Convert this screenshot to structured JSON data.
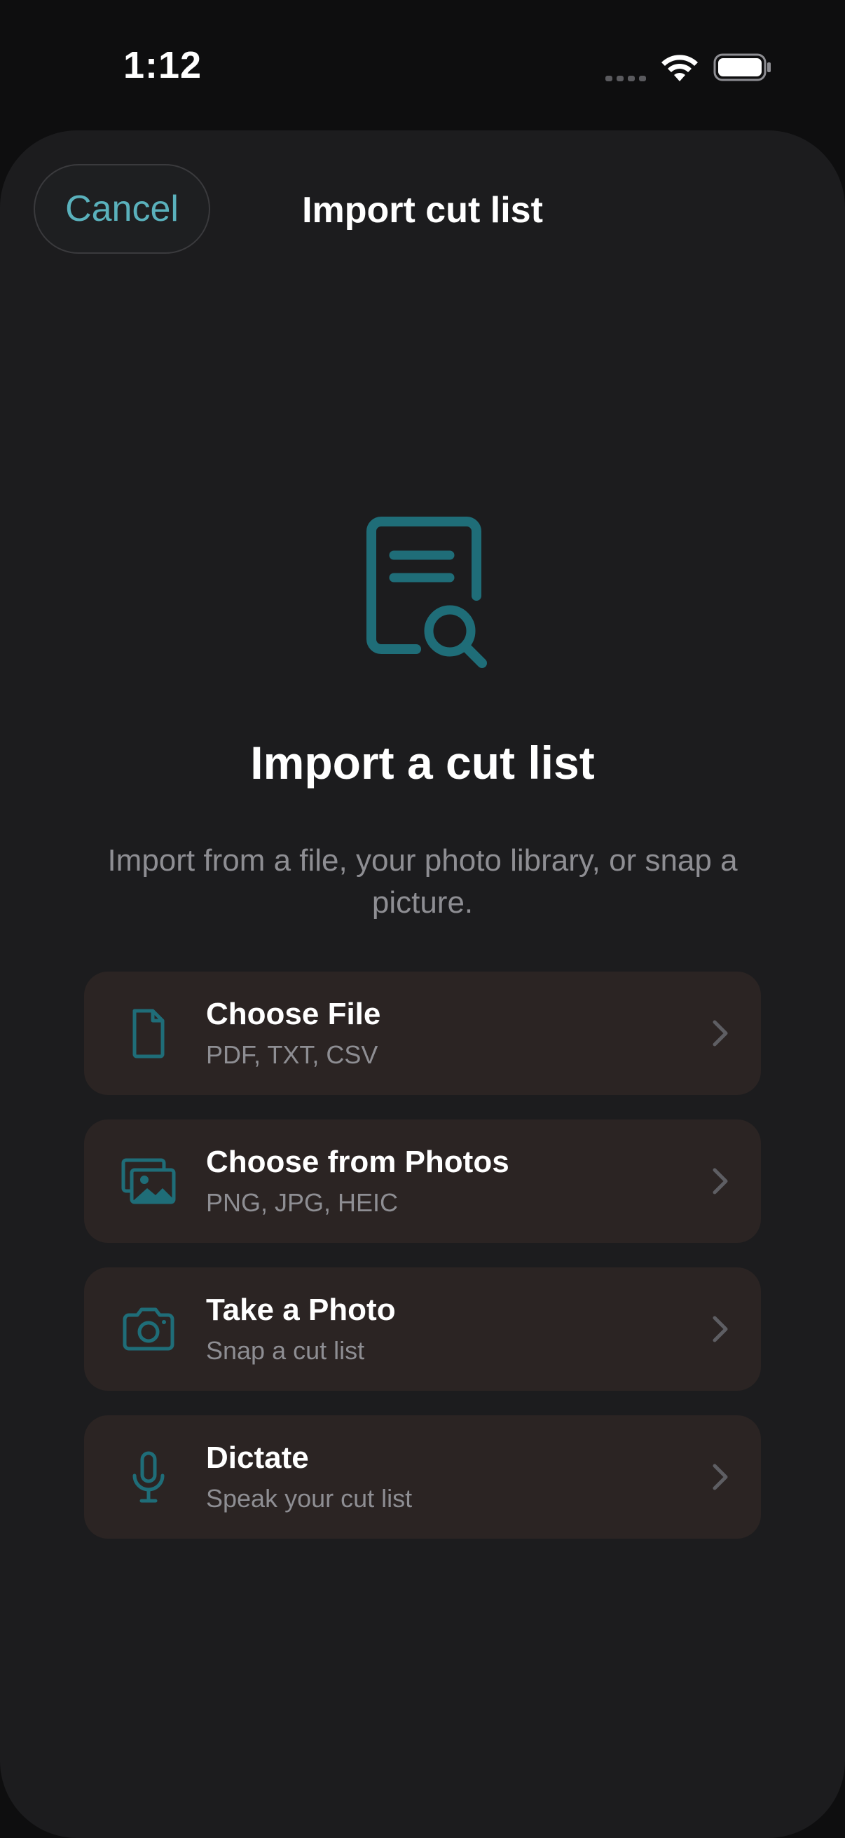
{
  "status_bar": {
    "time": "1:12"
  },
  "sheet": {
    "cancel_label": "Cancel",
    "title": "Import cut list"
  },
  "hero": {
    "icon": "document-search-icon",
    "heading": "Import a cut list",
    "description": "Import from a file, your photo library, or snap a picture."
  },
  "options": [
    {
      "title": "Choose File",
      "subtitle": "PDF, TXT, CSV",
      "icon": "file-icon"
    },
    {
      "title": "Choose from Photos",
      "subtitle": "PNG, JPG, HEIC",
      "icon": "photos-icon"
    },
    {
      "title": "Take a Photo",
      "subtitle": "Snap a cut list",
      "icon": "camera-icon"
    },
    {
      "title": "Dictate",
      "subtitle": "Speak your cut list",
      "icon": "microphone-icon"
    }
  ],
  "colors": {
    "accent": "#5ab1bc",
    "icon_teal": "#1f6d78",
    "sheet_background": "#1c1c1e",
    "card_background": "#2b2423",
    "secondary_text": "#8e8e93"
  }
}
